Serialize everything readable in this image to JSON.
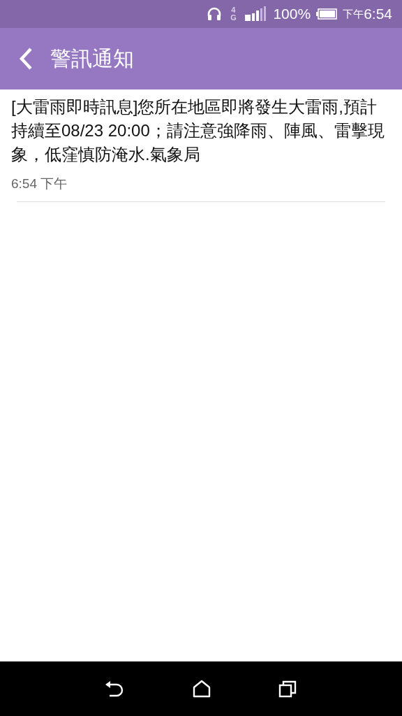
{
  "status_bar": {
    "network_type": "4G",
    "battery": "100%",
    "time_period": "下午",
    "time": "6:54"
  },
  "header": {
    "title": "警訊通知"
  },
  "messages": [
    {
      "text": "[大雷雨即時訊息]您所在地區即將發生大雷雨,預計持續至08/23 20:00；請注意強降雨、陣風、雷擊現象，低窪慎防淹水.氣象局",
      "time": "6:54 下午"
    }
  ]
}
